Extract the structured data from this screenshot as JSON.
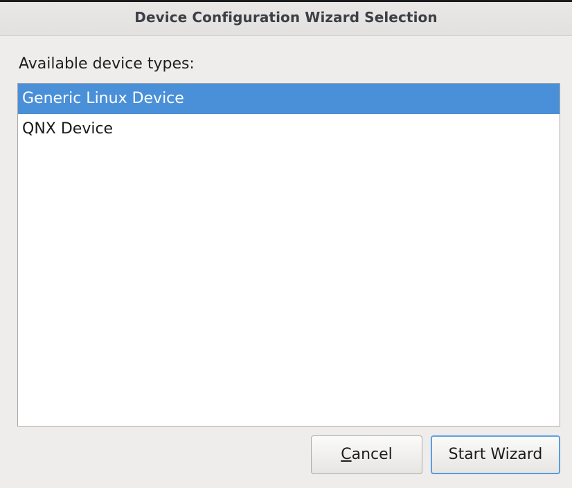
{
  "window": {
    "title": "Device Configuration Wizard Selection"
  },
  "list": {
    "label": "Available device types:",
    "items": [
      {
        "label": "Generic Linux Device",
        "selected": true
      },
      {
        "label": "QNX Device",
        "selected": false
      }
    ]
  },
  "buttons": {
    "cancel_mnemonic": "C",
    "cancel_rest": "ancel",
    "start_label": "Start Wizard"
  },
  "colors": {
    "selection": "#4a90d9",
    "dialog_background": "#eeedeb",
    "focus_border": "#4a90d9"
  }
}
